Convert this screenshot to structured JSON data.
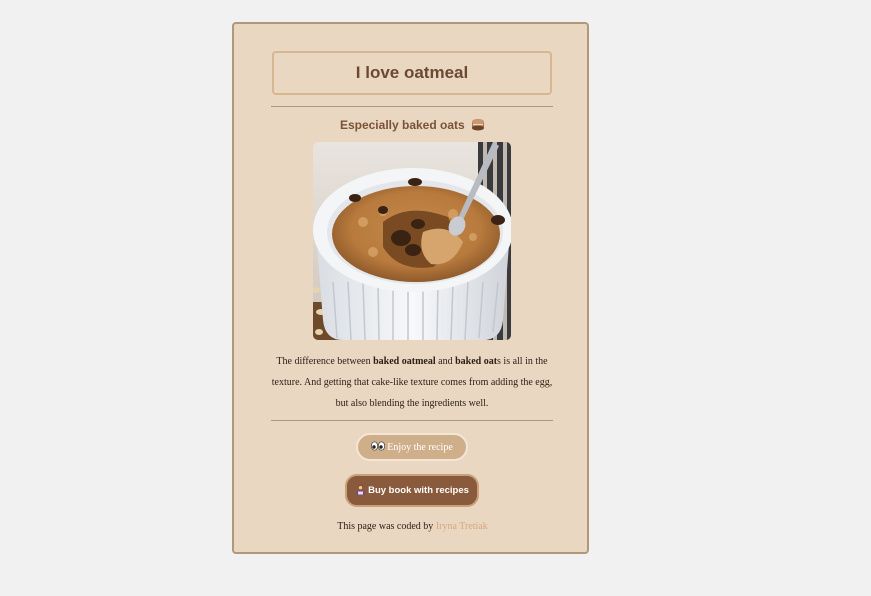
{
  "card": {
    "title": "I love oatmeal",
    "subtitle": "Especially baked oats",
    "subtitle_icon": "cake-icon",
    "image_subject": "baked oats in white ramekin with spoon",
    "description": {
      "part1": "The difference between ",
      "bold1": "baked oatmeal",
      "part2": " and ",
      "bold2": "baked oat",
      "part3": "s is all in the texture. And getting that cake-like texture comes from adding the egg, but also blending the ingredients well."
    },
    "buttons": {
      "enjoy_label": "Enjoy the recipe",
      "enjoy_icon": "eyes-icon",
      "buy_label": "Buy book with recipes",
      "buy_icon": "person-reading-icon"
    },
    "footer": {
      "text": "This page was coded by ",
      "author": "Iryna Tretiak"
    }
  },
  "colors": {
    "page_bg": "#f1f1f1",
    "card_bg": "#ead7c1",
    "title_color": "#6b4a33",
    "enjoy_button": "#cfae8a",
    "buy_button": "#8a5a3d",
    "author_link": "#d6a77b"
  }
}
